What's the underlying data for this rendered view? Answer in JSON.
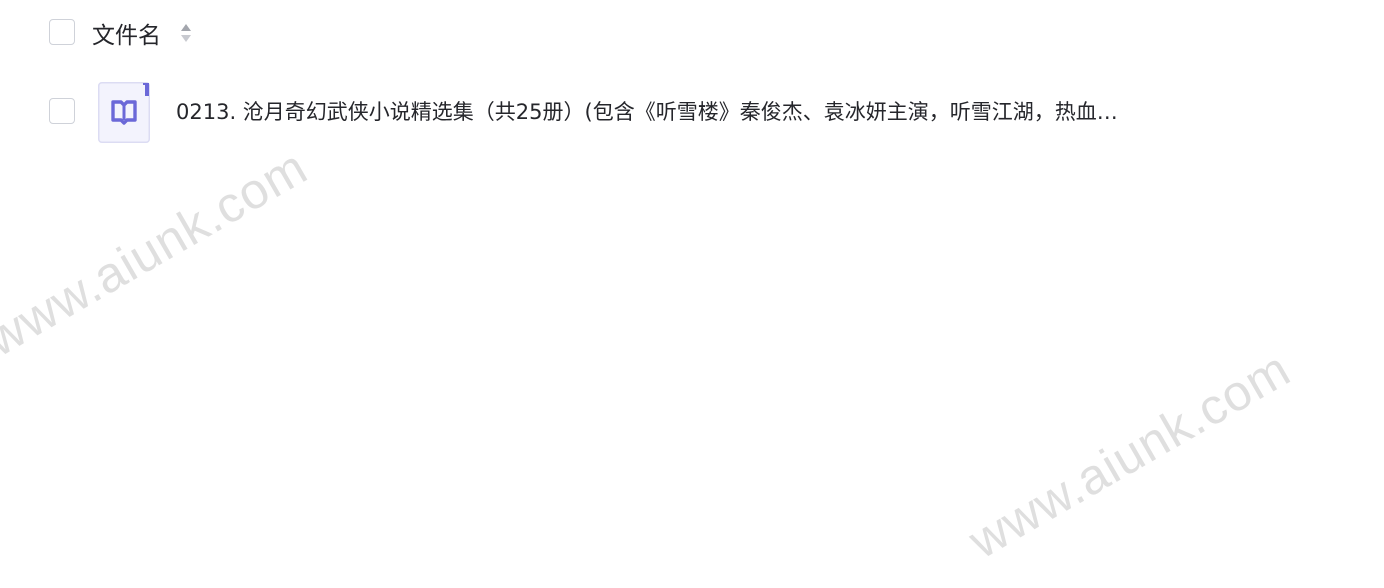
{
  "header": {
    "column_label": "文件名",
    "sort_icon": "sort-updown-icon"
  },
  "files": [
    {
      "icon": "book-file-icon",
      "name": "0213. 沧月奇幻武侠小说精选集（共25册）(包含《听雪楼》秦俊杰、袁冰妍主演，听雪江湖，热血…"
    }
  ],
  "watermark": {
    "text": "www.aiunk.com"
  },
  "colors": {
    "text": "#25262b",
    "checkbox_border": "#cfd2d9",
    "icon_accent": "#6b68d8",
    "icon_bg": "#f3f3fd",
    "sort_up": "#a3a6ad",
    "sort_down": "#c8cad0",
    "watermark": "#dadada"
  }
}
